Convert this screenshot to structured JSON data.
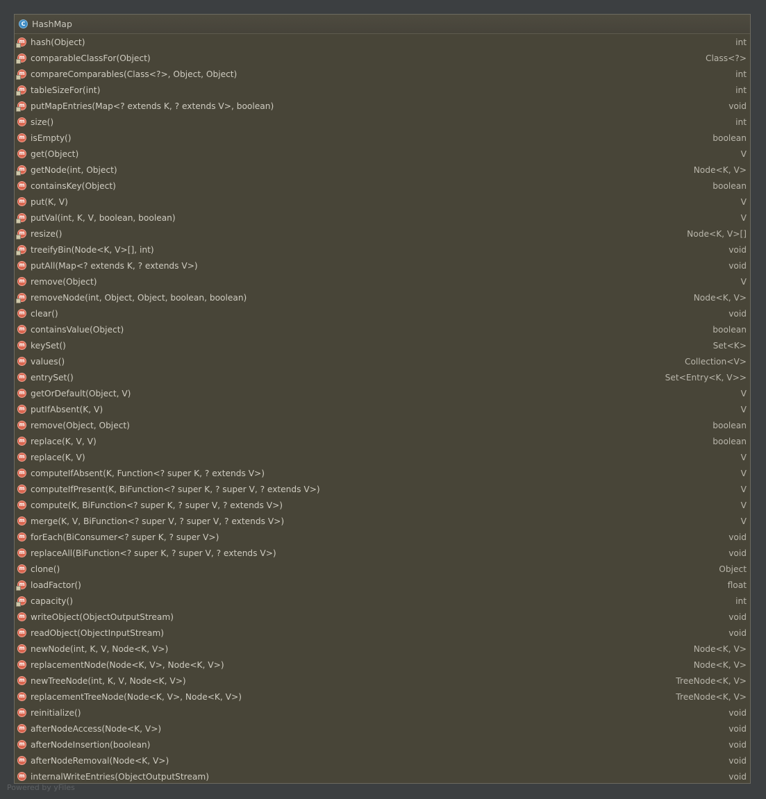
{
  "diagram": {
    "class_name": "HashMap",
    "class_icon": "C",
    "member_icon": "m",
    "footer": "Powered by yFiles",
    "colors": {
      "background": "#3c3f41",
      "box_fill": "#484538",
      "class_icon": "#3f8cc4",
      "method_icon": "#d9654f"
    },
    "methods": [
      {
        "sig": "hash(Object)",
        "ret": "int",
        "vis": "package"
      },
      {
        "sig": "comparableClassFor(Object)",
        "ret": "Class<?>",
        "vis": "package"
      },
      {
        "sig": "compareComparables(Class<?>, Object, Object)",
        "ret": "int",
        "vis": "package"
      },
      {
        "sig": "tableSizeFor(int)",
        "ret": "int",
        "vis": "package"
      },
      {
        "sig": "putMapEntries(Map<? extends K, ? extends V>, boolean)",
        "ret": "void",
        "vis": "package"
      },
      {
        "sig": "size()",
        "ret": "int",
        "vis": "public"
      },
      {
        "sig": "isEmpty()",
        "ret": "boolean",
        "vis": "public"
      },
      {
        "sig": "get(Object)",
        "ret": "V",
        "vis": "public"
      },
      {
        "sig": "getNode(int, Object)",
        "ret": "Node<K, V>",
        "vis": "package"
      },
      {
        "sig": "containsKey(Object)",
        "ret": "boolean",
        "vis": "public"
      },
      {
        "sig": "put(K, V)",
        "ret": "V",
        "vis": "public"
      },
      {
        "sig": "putVal(int, K, V, boolean, boolean)",
        "ret": "V",
        "vis": "package"
      },
      {
        "sig": "resize()",
        "ret": "Node<K, V>[]",
        "vis": "package"
      },
      {
        "sig": "treeifyBin(Node<K, V>[], int)",
        "ret": "void",
        "vis": "package"
      },
      {
        "sig": "putAll(Map<? extends K, ? extends V>)",
        "ret": "void",
        "vis": "public"
      },
      {
        "sig": "remove(Object)",
        "ret": "V",
        "vis": "public"
      },
      {
        "sig": "removeNode(int, Object, Object, boolean, boolean)",
        "ret": "Node<K, V>",
        "vis": "package"
      },
      {
        "sig": "clear()",
        "ret": "void",
        "vis": "public"
      },
      {
        "sig": "containsValue(Object)",
        "ret": "boolean",
        "vis": "public"
      },
      {
        "sig": "keySet()",
        "ret": "Set<K>",
        "vis": "public"
      },
      {
        "sig": "values()",
        "ret": "Collection<V>",
        "vis": "public"
      },
      {
        "sig": "entrySet()",
        "ret": "Set<Entry<K, V>>",
        "vis": "public"
      },
      {
        "sig": "getOrDefault(Object, V)",
        "ret": "V",
        "vis": "public"
      },
      {
        "sig": "putIfAbsent(K, V)",
        "ret": "V",
        "vis": "public"
      },
      {
        "sig": "remove(Object, Object)",
        "ret": "boolean",
        "vis": "public"
      },
      {
        "sig": "replace(K, V, V)",
        "ret": "boolean",
        "vis": "public"
      },
      {
        "sig": "replace(K, V)",
        "ret": "V",
        "vis": "public"
      },
      {
        "sig": "computeIfAbsent(K, Function<? super K, ? extends V>)",
        "ret": "V",
        "vis": "public"
      },
      {
        "sig": "computeIfPresent(K, BiFunction<? super K, ? super V, ? extends V>)",
        "ret": "V",
        "vis": "public"
      },
      {
        "sig": "compute(K, BiFunction<? super K, ? super V, ? extends V>)",
        "ret": "V",
        "vis": "public"
      },
      {
        "sig": "merge(K, V, BiFunction<? super V, ? super V, ? extends V>)",
        "ret": "V",
        "vis": "public"
      },
      {
        "sig": "forEach(BiConsumer<? super K, ? super V>)",
        "ret": "void",
        "vis": "public"
      },
      {
        "sig": "replaceAll(BiFunction<? super K, ? super V, ? extends V>)",
        "ret": "void",
        "vis": "public"
      },
      {
        "sig": "clone()",
        "ret": "Object",
        "vis": "public"
      },
      {
        "sig": "loadFactor()",
        "ret": "float",
        "vis": "package"
      },
      {
        "sig": "capacity()",
        "ret": "int",
        "vis": "package"
      },
      {
        "sig": "writeObject(ObjectOutputStream)",
        "ret": "void",
        "vis": "public"
      },
      {
        "sig": "readObject(ObjectInputStream)",
        "ret": "void",
        "vis": "public"
      },
      {
        "sig": "newNode(int, K, V, Node<K, V>)",
        "ret": "Node<K, V>",
        "vis": "public"
      },
      {
        "sig": "replacementNode(Node<K, V>, Node<K, V>)",
        "ret": "Node<K, V>",
        "vis": "public"
      },
      {
        "sig": "newTreeNode(int, K, V, Node<K, V>)",
        "ret": "TreeNode<K, V>",
        "vis": "public"
      },
      {
        "sig": "replacementTreeNode(Node<K, V>, Node<K, V>)",
        "ret": "TreeNode<K, V>",
        "vis": "public"
      },
      {
        "sig": "reinitialize()",
        "ret": "void",
        "vis": "public"
      },
      {
        "sig": "afterNodeAccess(Node<K, V>)",
        "ret": "void",
        "vis": "public"
      },
      {
        "sig": "afterNodeInsertion(boolean)",
        "ret": "void",
        "vis": "public"
      },
      {
        "sig": "afterNodeRemoval(Node<K, V>)",
        "ret": "void",
        "vis": "public"
      },
      {
        "sig": "internalWriteEntries(ObjectOutputStream)",
        "ret": "void",
        "vis": "public"
      }
    ]
  }
}
